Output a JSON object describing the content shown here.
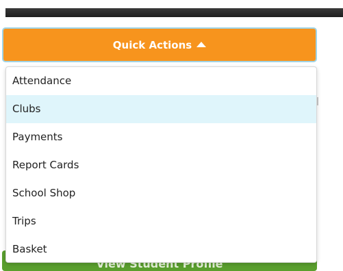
{
  "quick_actions": {
    "label": "Quick Actions"
  },
  "menu": {
    "items": [
      {
        "label": "Attendance"
      },
      {
        "label": "Clubs"
      },
      {
        "label": "Payments"
      },
      {
        "label": "Report Cards"
      },
      {
        "label": "School Shop"
      },
      {
        "label": "Trips"
      },
      {
        "label": "Basket"
      }
    ],
    "highlighted_index": 1
  },
  "profile_button": {
    "label": "View Student Profile"
  },
  "colors": {
    "accent": "#f7941d",
    "highlight": "#dff5fb",
    "profile": "#5a9f2e"
  },
  "icons": {
    "expand": "caret-up-icon"
  }
}
